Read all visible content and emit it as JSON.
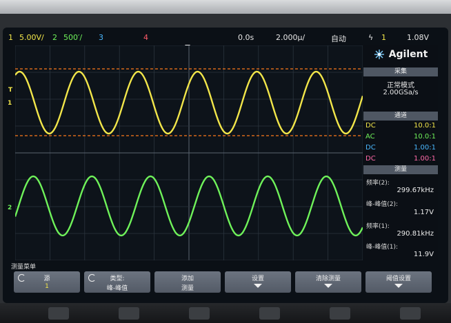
{
  "status": {
    "ch1_num": "1",
    "ch1_scale": "5.00V/",
    "ch2_num": "2",
    "ch2_scale": "500′/",
    "ch3_num": "3",
    "ch4_num": "4",
    "time_offset": "0.0s",
    "time_scale": "2.000µ/",
    "trigger_mode": "自动",
    "trigger_symbol": "ϟ",
    "trigger_source": "1",
    "trigger_level": "1.08V"
  },
  "markers": {
    "ch1": "1",
    "ch2": "2",
    "trig": "T"
  },
  "panel": {
    "brand": "Agilent",
    "acq_header": "采集",
    "acq_mode": "正常模式",
    "acq_rate": "2.00GSa/s",
    "probe_header": "通道",
    "probes": [
      {
        "coupling": "DC",
        "ratio": "10.0:1",
        "color": "#f2e64a"
      },
      {
        "coupling": "AC",
        "ratio": "10.0:1",
        "color": "#6ff25a"
      },
      {
        "coupling": "DC",
        "ratio": "1.00:1",
        "color": "#4ab8ff"
      },
      {
        "coupling": "DC",
        "ratio": "1.00:1",
        "color": "#ff6aa8"
      }
    ],
    "meas_header": "测量",
    "measurements": [
      {
        "label": "频率(2):",
        "value": "299.67kHz"
      },
      {
        "label": "峰-峰值(2):",
        "value": "1.17V"
      },
      {
        "label": "频率(1):",
        "value": "290.81kHz"
      },
      {
        "label": "峰-峰值(1):",
        "value": "11.9V"
      }
    ]
  },
  "menu": {
    "title": "测量菜单",
    "softkeys": [
      {
        "l1": "源",
        "l2": "1"
      },
      {
        "l1": "类型:",
        "l2": "峰-峰值"
      },
      {
        "l1": "添加",
        "l2": "测量"
      },
      {
        "l1": "设置",
        "l2": ""
      },
      {
        "l1": "清除测量",
        "l2": ""
      },
      {
        "l1": "阈值设置",
        "l2": ""
      }
    ]
  },
  "colors": {
    "ch1": "#f2e64a",
    "ch2": "#6ff25a",
    "ch3": "#4ab8ff",
    "ch4": "#ff5a6a",
    "cursor": "#ff7a1a"
  }
}
